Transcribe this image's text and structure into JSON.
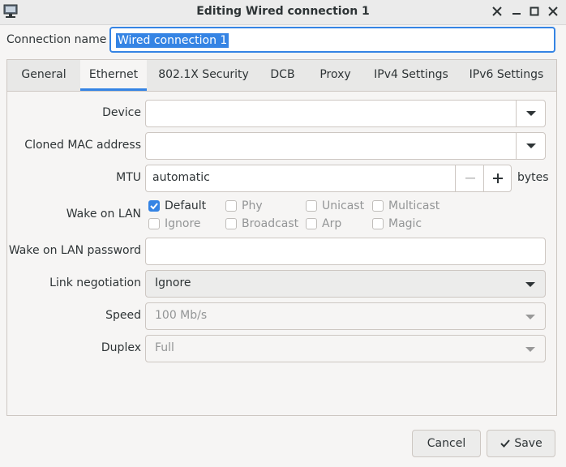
{
  "window": {
    "title": "Editing Wired connection 1"
  },
  "connection": {
    "label": "Connection name",
    "value": "Wired connection 1"
  },
  "tabs": [
    "General",
    "Ethernet",
    "802.1X Security",
    "DCB",
    "Proxy",
    "IPv4 Settings",
    "IPv6 Settings"
  ],
  "active_tab": "Ethernet",
  "fields": {
    "device": {
      "label": "Device",
      "value": ""
    },
    "cloned_mac": {
      "label": "Cloned MAC address",
      "value": ""
    },
    "mtu": {
      "label": "MTU",
      "value": "automatic",
      "unit": "bytes"
    },
    "wol": {
      "label": "Wake on LAN",
      "options": {
        "default": {
          "label": "Default",
          "checked": true
        },
        "phy": {
          "label": "Phy",
          "checked": false
        },
        "unicast": {
          "label": "Unicast",
          "checked": false
        },
        "multicast": {
          "label": "Multicast",
          "checked": false
        },
        "ignore": {
          "label": "Ignore",
          "checked": false
        },
        "broadcast": {
          "label": "Broadcast",
          "checked": false
        },
        "arp": {
          "label": "Arp",
          "checked": false
        },
        "magic": {
          "label": "Magic",
          "checked": false
        }
      }
    },
    "wol_password": {
      "label": "Wake on LAN password",
      "value": ""
    },
    "link_negotiation": {
      "label": "Link negotiation",
      "value": "Ignore"
    },
    "speed": {
      "label": "Speed",
      "value": "100 Mb/s"
    },
    "duplex": {
      "label": "Duplex",
      "value": "Full"
    }
  },
  "buttons": {
    "cancel": "Cancel",
    "save": "Save"
  },
  "colors": {
    "accent": "#3584e4",
    "background": "#f6f5f4",
    "text": "#2e3436",
    "disabled_text": "#939596"
  }
}
